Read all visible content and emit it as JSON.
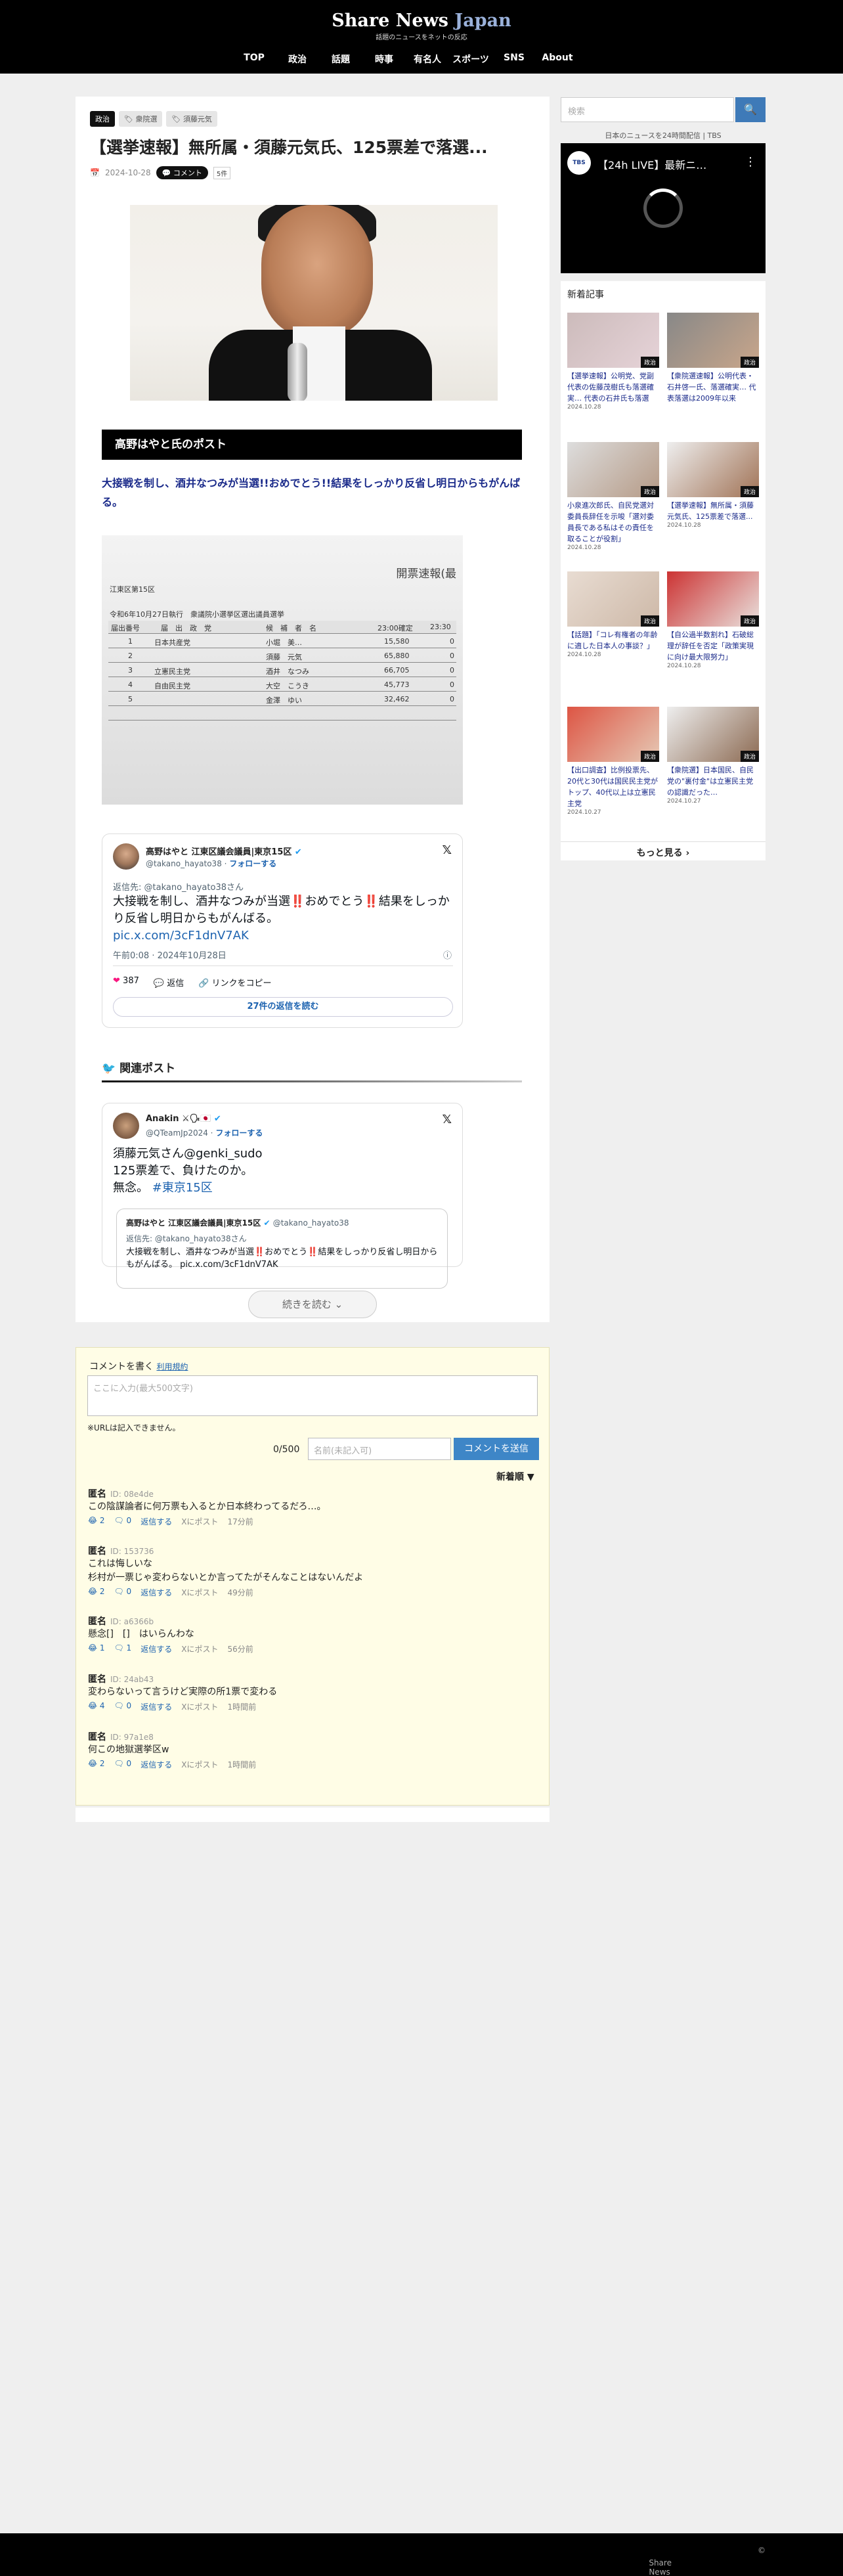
{
  "header": {
    "logo_main": "Share News",
    "logo_accent": "Japan",
    "tagline": "話題のニュースをネットの反応",
    "nav": [
      "TOP",
      "政治",
      "話題",
      "時事",
      "有名人",
      "スポーツ",
      "SNS",
      "About"
    ]
  },
  "article": {
    "tags": [
      "政治",
      "衆院選",
      "須藤元気"
    ],
    "title": "【選挙速報】無所属・須藤元気氏、125票差で落選...",
    "date": "2024-10-28",
    "comment_label": "コメント",
    "comment_count": "5件",
    "bar_title": "高野はやと氏のポスト",
    "lead": "大接戦を制し、酒井なつみが当選!!おめでとう!!結果をしっかり反省し明日からもがんばる。",
    "doc": {
      "head": "開票速報(最",
      "district": "江東区第15区",
      "issued": "令和6年10月27日執行　衆議院小選挙区選出議員選挙",
      "cols": [
        "届出番号",
        "届　出　政　党",
        "候　補　者　名",
        "23:00確定",
        "23:30"
      ],
      "rows": [
        [
          "1",
          "日本共産党",
          "小堀　美…",
          "15,580",
          "0"
        ],
        [
          "2",
          "",
          "須藤　元気",
          "65,880",
          "0"
        ],
        [
          "3",
          "立憲民主党",
          "酒井　なつみ",
          "66,705",
          "0"
        ],
        [
          "4",
          "自由民主党",
          "大空　こうき",
          "45,773",
          "0"
        ],
        [
          "5",
          "",
          "金澤　ゆい",
          "32,462",
          "0"
        ]
      ]
    },
    "tweet": {
      "name": "高野はやと 江東区議会議員|東京15区",
      "handle": "@takano_hayato38",
      "follow": "フォローする",
      "reply_to": "返信先: @takano_hayato38さん",
      "text": "大接戦を制し、酒井なつみが当選‼️おめでとう‼️結果をしっかり反省し明日からもがんばる。",
      "link": "pic.x.com/3cF1dnV7AK",
      "time": "午前0:08 · 2024年10月28日",
      "likes": "387",
      "reply": "返信",
      "copy": "リンクをコピー",
      "read": "27件の返信を読む"
    },
    "related_title": "関連ポスト",
    "tweet2": {
      "name": "Anakin",
      "handle": "@QTeamJp2024",
      "follow": "フォローする",
      "mention": "須藤元気さん@genki_sudo",
      "line2": "125票差で、負けたのか。",
      "line3": "無念。",
      "hashtag": "#東京15区",
      "q_name": "高野はやと 江東区議会議員|東京15区",
      "q_handle": "@takano_hayato38",
      "q_reply": "返信先: @takano_hayato38さん",
      "q_text": "大接戦を制し、酒井なつみが当選‼️おめでとう‼️結果をしっかり反省し明日からもがんばる。 pic.x.com/3cF1dnV7AK"
    },
    "more": "続きを読む"
  },
  "sidebar": {
    "search_placeholder": "検索",
    "caption": "日本のニュースを24時間配信 | TBS",
    "video_title": "【24h LIVE】最新ニ…",
    "new_title": "新着記事",
    "cards": [
      {
        "text": "【選挙速報】公明党、党副代表の佐藤茂樹氏も落選確実… 代表の石井氏も落選",
        "date": "2024.10.28",
        "label": "政治"
      },
      {
        "text": "【衆院選速報】公明代表・石井啓一氏、落選確実… 代表落選は2009年以来",
        "date": "",
        "label": "政治"
      },
      {
        "text": "小泉進次郎氏、自民党選対委員長辞任を示唆「選対委員長である私はその責任を取ることが役割」",
        "date": "2024.10.28",
        "label": "政治"
      },
      {
        "text": "【選挙速報】無所属・須藤元気氏、125票差で落選...",
        "date": "2024.10.28",
        "label": "政治"
      },
      {
        "text": "【話題】「コレ有権者の年齢に適した日本人の事談？」",
        "date": "2024.10.28",
        "label": "政治"
      },
      {
        "text": "【自公過半数割れ】石破総理が辞任を否定「政策実現に向け最大限努力」",
        "date": "2024.10.28",
        "label": "政治"
      },
      {
        "text": "【出口調査】比例投票先、20代と30代は国民民主党がトップ、40代以上は立憲民主党",
        "date": "2024.10.27",
        "label": "政治"
      },
      {
        "text": "【衆院選】日本国民、自民党の\"裏付金\"は立憲民主党の認識だった…",
        "date": "2024.10.27",
        "label": "政治"
      }
    ],
    "more": "もっと見る"
  },
  "comments": {
    "header": "コメントを書く",
    "rules": "利用規約",
    "placeholder": "ここに入力(最大500文字)",
    "note": "※URLは記入できません。",
    "counter": "0/500",
    "name_placeholder": "名前(未記入可)",
    "submit": "コメントを送信",
    "sort": "新着順",
    "items": [
      {
        "name": "匿名",
        "id": "ID: 08e4de",
        "body": "この陰謀論者に何万票も入るとか日本終わってるだろ…。",
        "good": "2",
        "bad": "0",
        "reply": "返信する",
        "x": "Xにポスト",
        "time": "17分前"
      },
      {
        "name": "匿名",
        "id": "ID: 153736",
        "body": "これは悔しいな\n杉村が一票じゃ変わらないとか言ってたがそんなことはないんだよ",
        "good": "2",
        "bad": "0",
        "reply": "返信する",
        "x": "Xにポスト",
        "time": "49分前"
      },
      {
        "name": "匿名",
        "id": "ID: a6366b",
        "body": "懸念[]　[]　はいらんわな",
        "good": "1",
        "bad": "1",
        "reply": "返信する",
        "x": "Xにポスト",
        "time": "56分前"
      },
      {
        "name": "匿名",
        "id": "ID: 24ab43",
        "body": "変わらないって言うけど実際の所1票で変わる",
        "good": "4",
        "bad": "0",
        "reply": "返信する",
        "x": "Xにポスト",
        "time": "1時間前"
      },
      {
        "name": "匿名",
        "id": "ID: 97a1e8",
        "body": "何この地獄選挙区w",
        "good": "2",
        "bad": "0",
        "reply": "返信する",
        "x": "Xにポスト",
        "time": "1時間前"
      }
    ]
  },
  "footer": {
    "copyright": "Share News Japan All Rights Reserved."
  }
}
